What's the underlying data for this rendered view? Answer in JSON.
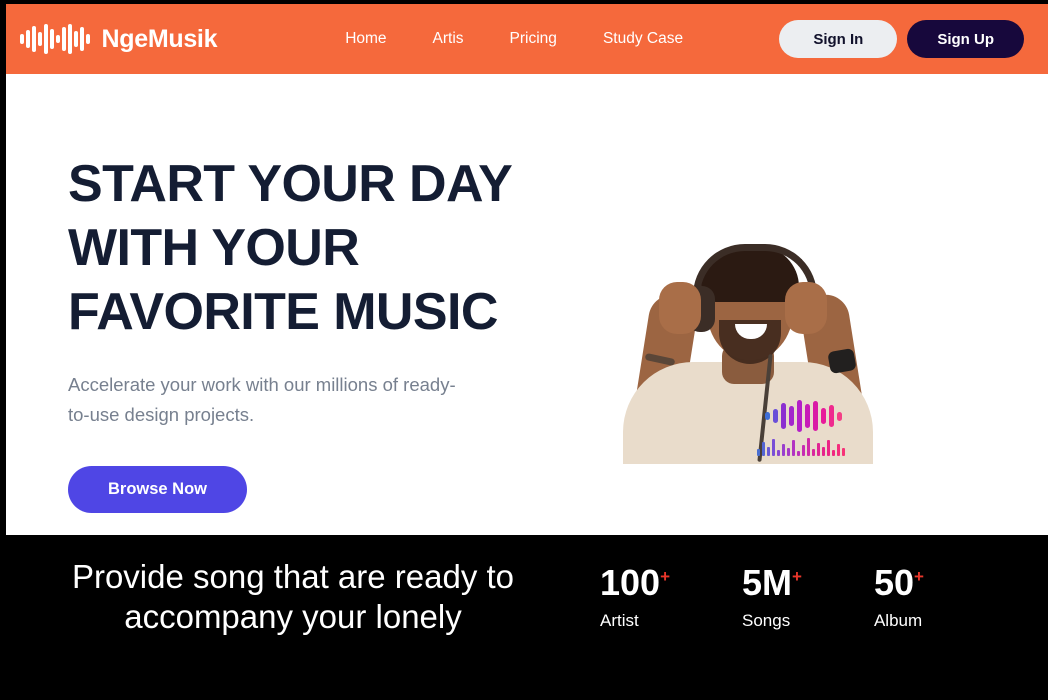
{
  "brand": {
    "name": "NgeMusik",
    "logo_icon": "audio-waveform-icon",
    "header_bg": "#f5693c"
  },
  "nav": {
    "links": [
      {
        "label": "Home"
      },
      {
        "label": "Artis"
      },
      {
        "label": "Pricing"
      },
      {
        "label": "Study Case"
      }
    ],
    "sign_in_label": "Sign In",
    "sign_up_label": "Sign Up",
    "sign_in_bg": "#eceef1",
    "sign_up_bg": "#17083c"
  },
  "hero": {
    "title_line1": "START YOUR DAY",
    "title_line2": "WITH YOUR",
    "title_line3": "FAVORITE MUSIC",
    "title_color": "#141d33",
    "subtitle_line1": "Accelerate your work with our millions",
    "subtitle_line2": "of ready-to-use design projects.",
    "subtitle_color": "#77808f",
    "cta_label": "Browse Now",
    "cta_bg": "#4f46e5",
    "image_alt": "smiling-man-wearing-headphones"
  },
  "band": {
    "bg": "#000000",
    "headline_line1": "Provide song that are ready to",
    "headline_line2": "accompany your lonely",
    "stats": [
      {
        "value": "100",
        "plus": "+",
        "label": "Artist"
      },
      {
        "value": "5M",
        "plus": "+",
        "label": "Songs"
      },
      {
        "value": "50",
        "plus": "+",
        "label": "Album"
      }
    ],
    "plus_color": "#e8362a"
  }
}
